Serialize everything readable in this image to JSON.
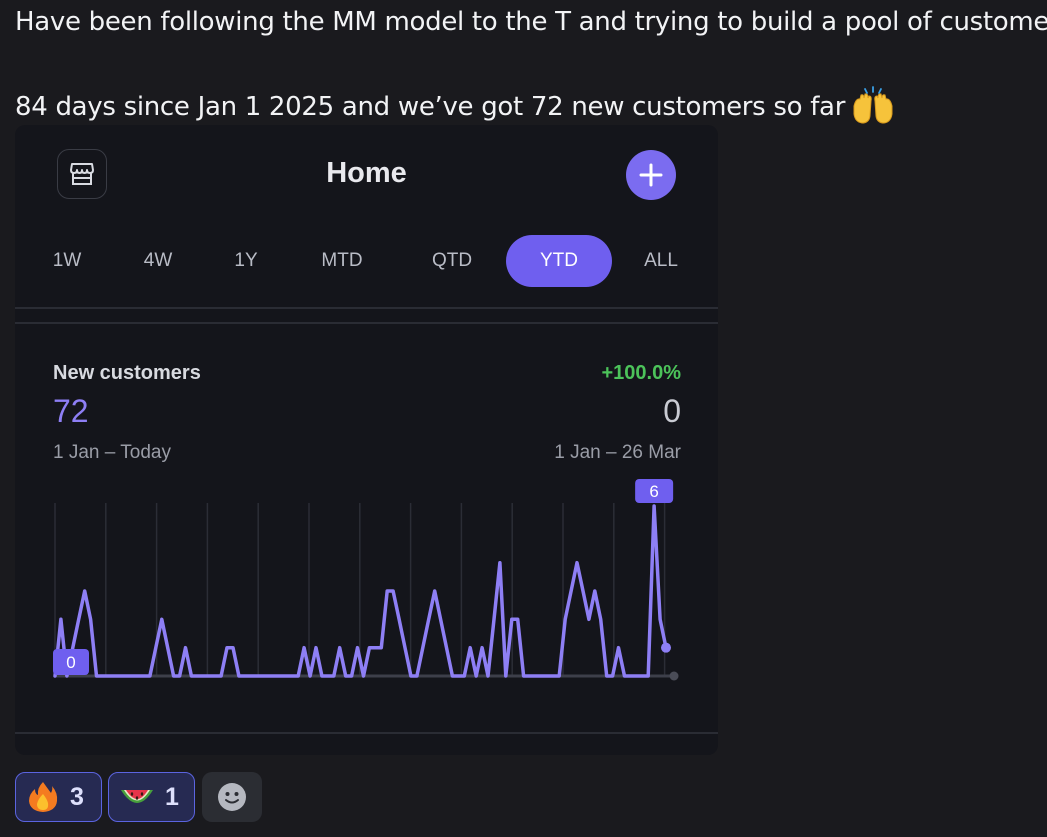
{
  "message": {
    "line1": "Have been following the MM model to the T and trying to build a pool of customers.",
    "line2": "84 days since Jan 1 2025 and we’ve got 72 new customers so far",
    "emoji": "raising-hands-emoji"
  },
  "app": {
    "title": "Home",
    "tabs": [
      {
        "label": "1W",
        "active": false
      },
      {
        "label": "4W",
        "active": false
      },
      {
        "label": "1Y",
        "active": false
      },
      {
        "label": "MTD",
        "active": false
      },
      {
        "label": "QTD",
        "active": false
      },
      {
        "label": "YTD",
        "active": true
      },
      {
        "label": "ALL",
        "active": false
      }
    ],
    "accent_color": "#6f5fef",
    "metric": {
      "label": "New customers",
      "value": "72",
      "range": "1 Jan – Today",
      "change": "+100.0%",
      "change_color": "#4cc35a",
      "previous_value": "0",
      "previous_range": "1 Jan – 26 Mar"
    }
  },
  "chart_data": {
    "type": "line",
    "series": [
      {
        "color": "#8e7ff5",
        "values": [
          0,
          2,
          0,
          1,
          2,
          3,
          2,
          0,
          0,
          0,
          0,
          0,
          0,
          0,
          0,
          0,
          0,
          1,
          2,
          1,
          0,
          0,
          1,
          0,
          0,
          0,
          0,
          0,
          0,
          1,
          1,
          0,
          0,
          0,
          0,
          0,
          0,
          0,
          0,
          0,
          0,
          0,
          1,
          0,
          1,
          0,
          0,
          0,
          1,
          0,
          0,
          1,
          0,
          1,
          1,
          1,
          3,
          3,
          2,
          1,
          0,
          0,
          1,
          2,
          3,
          2,
          1,
          0,
          0,
          0,
          1,
          0,
          1,
          0,
          2,
          4,
          0,
          2,
          2,
          0,
          0,
          0,
          0,
          0,
          0,
          0,
          2,
          3,
          4,
          3,
          2,
          3,
          2,
          0,
          0,
          1,
          0,
          0,
          0,
          0,
          0,
          6,
          2,
          1
        ]
      }
    ],
    "ylim": [
      0,
      6
    ],
    "start_label": "0",
    "peak_label": "6",
    "grid": "vertical"
  },
  "reactions": [
    {
      "emoji": "fire-emoji",
      "count": "3"
    },
    {
      "emoji": "watermelon-emoji",
      "count": "1"
    }
  ],
  "add_reaction_icon": "smiley-icon"
}
